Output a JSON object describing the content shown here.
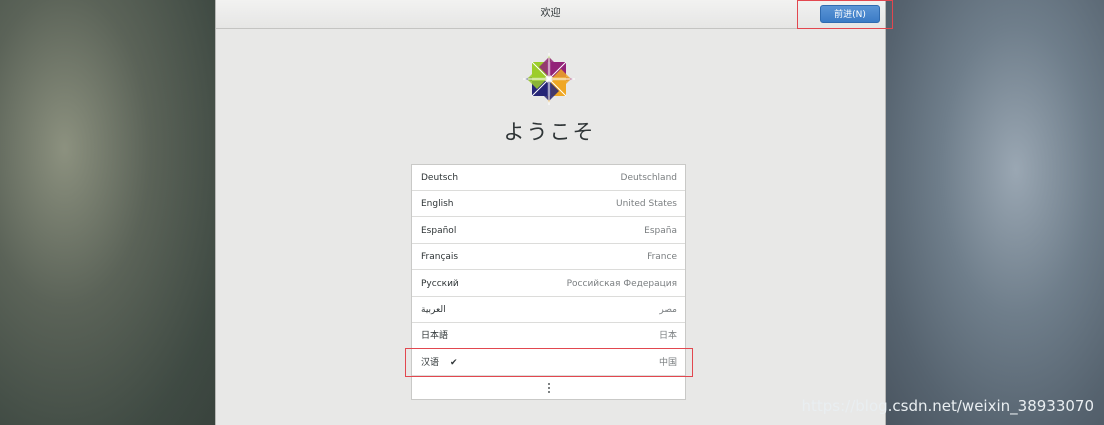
{
  "window": {
    "title": "欢迎",
    "next_button": "前进(N)"
  },
  "welcome_heading": "ようこそ",
  "languages": [
    {
      "name": "Deutsch",
      "region": "Deutschland",
      "selected": false
    },
    {
      "name": "English",
      "region": "United States",
      "selected": false
    },
    {
      "name": "Español",
      "region": "España",
      "selected": false
    },
    {
      "name": "Français",
      "region": "France",
      "selected": false
    },
    {
      "name": "Русский",
      "region": "Российская Федерация",
      "selected": false
    },
    {
      "name": "العربية",
      "region": "مصر",
      "selected": false
    },
    {
      "name": "日本語",
      "region": "日本",
      "selected": false
    },
    {
      "name": "汉语",
      "region": "中国",
      "selected": true
    }
  ],
  "selected_mark": "✔",
  "more_icon": "more-vertical-icon",
  "watermark": "https://blog.csdn.net/weixin_38933070",
  "colors": {
    "accent": "#3b7bc6",
    "highlight_box": "#e2474f"
  }
}
